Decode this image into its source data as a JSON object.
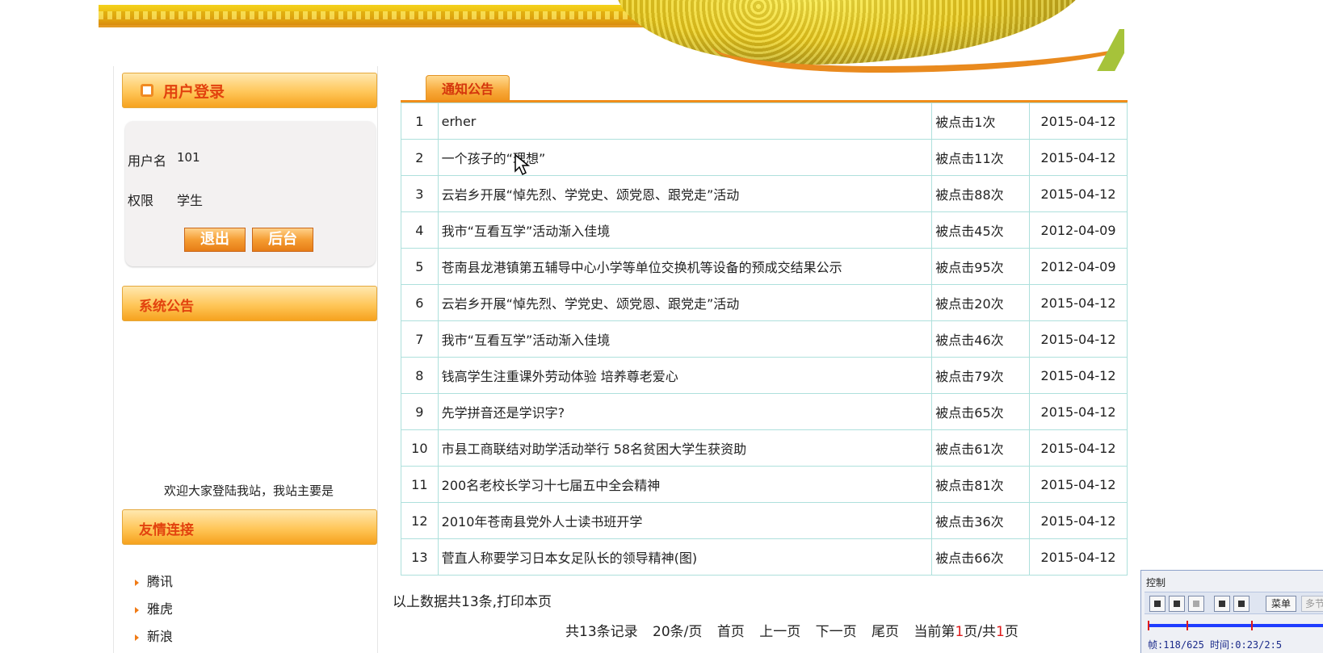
{
  "login": {
    "title": "用户登录",
    "username_label": "用户名",
    "username_value": "101",
    "permission_label": "权限",
    "permission_value": "学生",
    "logout_button": "退出",
    "admin_button": "后台"
  },
  "system_notice": {
    "title": "系统公告",
    "scroll_text": "欢迎大家登陆我站，我站主要是"
  },
  "friend_links": {
    "title": "友情连接",
    "items": [
      "腾讯",
      "雅虎",
      "新浪"
    ]
  },
  "notices": {
    "tab_label": "通知公告",
    "rows": [
      {
        "num": "1",
        "title": "erher",
        "clicks": "被点击1次",
        "date": "2015-04-12"
      },
      {
        "num": "2",
        "title": "一个孩子的“理想”",
        "clicks": "被点击11次",
        "date": "2015-04-12"
      },
      {
        "num": "3",
        "title": "云岩乡开展“悼先烈、学党史、颂党恩、跟党走”活动",
        "clicks": "被点击88次",
        "date": "2015-04-12"
      },
      {
        "num": "4",
        "title": "我市“互看互学”活动渐入佳境",
        "clicks": "被点击45次",
        "date": "2012-04-09"
      },
      {
        "num": "5",
        "title": "苍南县龙港镇第五辅导中心小学等单位交换机等设备的预成交结果公示",
        "clicks": "被点击95次",
        "date": "2012-04-09"
      },
      {
        "num": "6",
        "title": "云岩乡开展“悼先烈、学党史、颂党恩、跟党走”活动",
        "clicks": "被点击20次",
        "date": "2015-04-12"
      },
      {
        "num": "7",
        "title": "我市“互看互学”活动渐入佳境",
        "clicks": "被点击46次",
        "date": "2015-04-12"
      },
      {
        "num": "8",
        "title": "钱高学生注重课外劳动体验 培养尊老爱心",
        "clicks": "被点击79次",
        "date": "2015-04-12"
      },
      {
        "num": "9",
        "title": "先学拼音还是学识字?",
        "clicks": "被点击65次",
        "date": "2015-04-12"
      },
      {
        "num": "10",
        "title": "市县工商联结对助学活动举行 58名贫困大学生获资助",
        "clicks": "被点击61次",
        "date": "2015-04-12"
      },
      {
        "num": "11",
        "title": "200名老校长学习十七届五中全会精神",
        "clicks": "被点击81次",
        "date": "2015-04-12"
      },
      {
        "num": "12",
        "title": "2010年苍南县党外人士读书班开学",
        "clicks": "被点击36次",
        "date": "2015-04-12"
      },
      {
        "num": "13",
        "title": "菅直人称要学习日本女足队长的领导精神(图)",
        "clicks": "被点击66次",
        "date": "2015-04-12"
      }
    ]
  },
  "summary": "以上数据共13条,打印本页",
  "pager": {
    "total": "共13条记录",
    "per_page": "20条/页",
    "first": "首页",
    "prev": "上一页",
    "next": "下一页",
    "last": "尾页",
    "current_prefix": "当前第",
    "current_page": "1",
    "current_mid": "页/共",
    "total_pages": "1",
    "current_suffix": "页"
  },
  "control_panel": {
    "title": "控制",
    "menu_button": "菜单",
    "more_button": "多节",
    "status": "帧:118/625 时间:0:23/2:5"
  },
  "colors": {
    "accent_orange": "#f08d1a",
    "header_text": "#e2420e",
    "table_border": "#aee0dc",
    "page_number_red": "#e01b1b"
  }
}
